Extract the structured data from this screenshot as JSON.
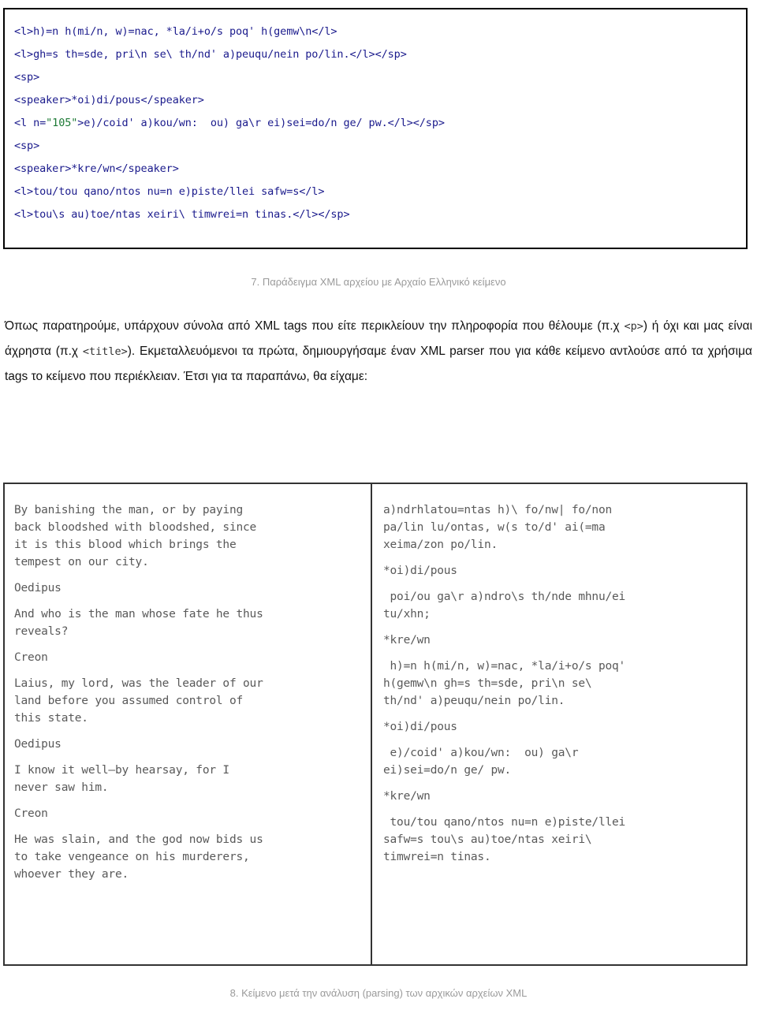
{
  "code_listing": {
    "lines": [
      {
        "text": "<l>h)=n h(mi/n, w)=nac, *la/i+o/s poq' h(gemw\\n</l>"
      },
      {
        "text": "<l>gh=s th=sde, pri\\n se\\ th/nd' a)peuqu/nein po/lin.</l></sp>"
      },
      {
        "text": "<sp>"
      },
      {
        "text": "<speaker>*oi)di/pous</speaker>"
      },
      {
        "pre": "<l n=",
        "attr": "\"105\"",
        "post": ">e)/coid' a)kou/wn:  ou) ga\\r ei)sei=do/n ge/ pw.</l></sp>"
      },
      {
        "text": "<sp>"
      },
      {
        "text": "<speaker>*kre/wn</speaker>"
      },
      {
        "text": "<l>tou/tou qano/ntos nu=n e)piste/llei safw=s</l>"
      },
      {
        "text": "<l>tou\\s au)toe/ntas xeiri\\ timwrei=n tinas.</l></sp>"
      }
    ]
  },
  "caption_7": "7. Παράδειγμα XML αρχείου με Αρχαίο Ελληνικό κείμενο",
  "caption_8": "8. Κείμενο μετά την ανάλυση (parsing) των αρχικών αρχείων XML",
  "paragraph": {
    "part1": "Όπως παρατηρούμε, υπάρχουν σύνολα από XML tags που είτε περικλείουν την πληροφορία που θέλουμε (π.χ ",
    "mono1": "<p>",
    "part2": ") ή όχι και μας είναι άχρηστα (π.χ ",
    "mono2": "<title>",
    "part3": "). Εκμεταλλευόμενοι τα πρώτα, δημιουργήσαμε έναν XML parser που για κάθε κείμενο αντλούσε από τα χρήσιμα tags το κείμενο που περιέκλειαν. Έτσι για τα παραπάνω, θα είχαμε:"
  },
  "parsed_text": {
    "left_column": [
      "By banishing the man, or by paying\nback bloodshed with bloodshed, since\nit is this blood which brings the\ntempest on our city.",
      "Oedipus",
      "And who is the man whose fate he thus\nreveals?",
      "Creon",
      "Laius, my lord, was the leader of our\nland before you assumed control of\nthis state.",
      "Oedipus",
      "I know it well—by hearsay, for I\nnever saw him.",
      "Creon",
      "He was slain, and the god now bids us\nto take vengeance on his murderers,\nwhoever they are."
    ],
    "right_column": [
      "a)ndrhlatou=ntas h)\\ fo/nw| fo/non\npa/lin lu/ontas, w(s to/d' ai(=ma\nxeima/zon po/lin.",
      "*oi)di/pous",
      " poi/ou ga\\r a)ndro\\s th/nde mhnu/ei\ntu/xhn;",
      "*kre/wn",
      " h)=n h(mi/n, w)=nac, *la/i+o/s poq'\nh(gemw\\n gh=s th=sde, pri\\n se\\\nth/nd' a)peuqu/nein po/lin.",
      "*oi)di/pous",
      " e)/coid' a)kou/wn:  ou) ga\\r\nei)sei=do/n ge/ pw.",
      "*kre/wn",
      " tou/tou qano/ntos nu=n e)piste/llei\nsafw=s tou\\s au)toe/ntas xeiri\\\ntimwrei=n tinas."
    ]
  },
  "colors": {
    "xml_tag": "#1a1a8c",
    "xml_attr_value": "#1d7a35",
    "caption_gray": "#9a9a9a",
    "parsed_text_gray": "#595959"
  }
}
